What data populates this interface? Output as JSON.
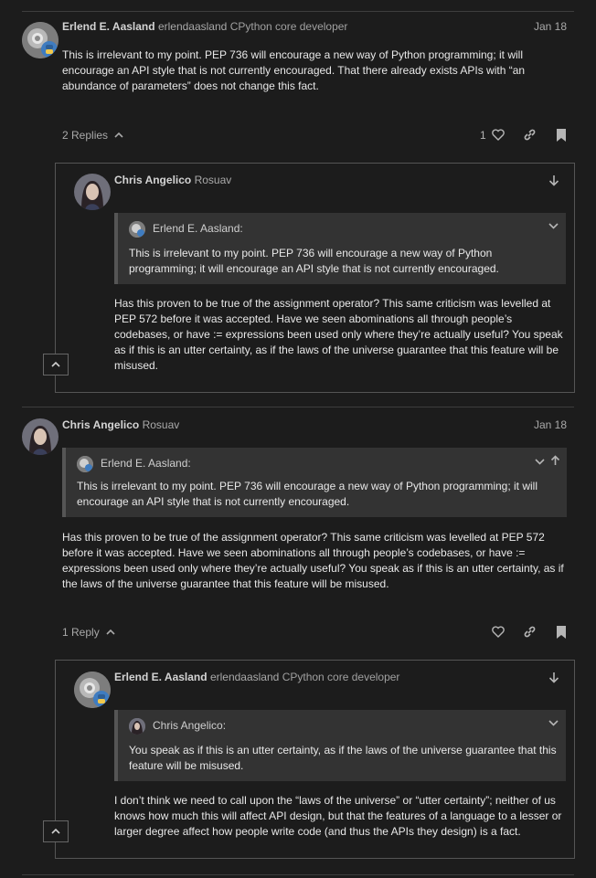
{
  "posts": [
    {
      "author": "Erlend E. Aasland",
      "handle": "erlendaasland",
      "user_title": "CPython core developer",
      "date": "Jan 18",
      "body": "This is irrelevant to my point. PEP 736 will encourage a new way of Python programming; it will encourage an API style that is not currently encouraged. That there already exists APIs with “an abundance of parameters” does not change this fact.",
      "replies_label": "2 Replies",
      "like_count": "1",
      "embedded_reply": {
        "author": "Chris Angelico",
        "handle": "Rosuav",
        "quote_author": "Erlend E. Aasland:",
        "quote_text": "This is irrelevant to my point. PEP 736 will encourage a new way of Python programming; it will encourage an API style that is not currently encouraged.",
        "body": "Has this proven to be true of the assignment operator? This same criticism was levelled at PEP 572 before it was accepted. Have we seen abominations all through people’s codebases, or have := expressions been used only where they’re actually useful? You speak as if this is an utter certainty, as if the laws of the universe guarantee that this feature will be misused."
      }
    },
    {
      "author": "Chris Angelico",
      "handle": "Rosuav",
      "date": "Jan 18",
      "quote_author": "Erlend E. Aasland:",
      "quote_text": "This is irrelevant to my point. PEP 736 will encourage a new way of Python programming; it will encourage an API style that is not currently encouraged.",
      "body": "Has this proven to be true of the assignment operator? This same criticism was levelled at PEP 572 before it was accepted. Have we seen abominations all through people’s codebases, or have := expressions been used only where they’re actually useful? You speak as if this is an utter certainty, as if the laws of the universe guarantee that this feature will be misused.",
      "replies_label": "1 Reply",
      "embedded_reply": {
        "author": "Erlend E. Aasland",
        "handle": "erlendaasland",
        "user_title": "CPython core developer",
        "quote_author": "Chris Angelico:",
        "quote_text": "You speak as if this is an utter certainty, as if the laws of the universe guarantee that this feature will be misused.",
        "body": "I don’t think we need to call upon the “laws of the universe” or “utter certainty”; neither of us knows how much this will affect API design, but that the features of a language to a lesser or larger degree affect how people write code (and thus the APIs they design) is a fact."
      }
    }
  ],
  "colors": {
    "background": "#1c1c1c",
    "quote_bg": "#333333",
    "python_blue": "#3f7cc0",
    "python_yellow": "#f2c94c"
  },
  "icons": [
    "heart-icon",
    "link-icon",
    "bookmark-icon",
    "chevron-up-icon",
    "chevron-down-icon",
    "arrow-down-icon",
    "arrow-up-icon"
  ]
}
